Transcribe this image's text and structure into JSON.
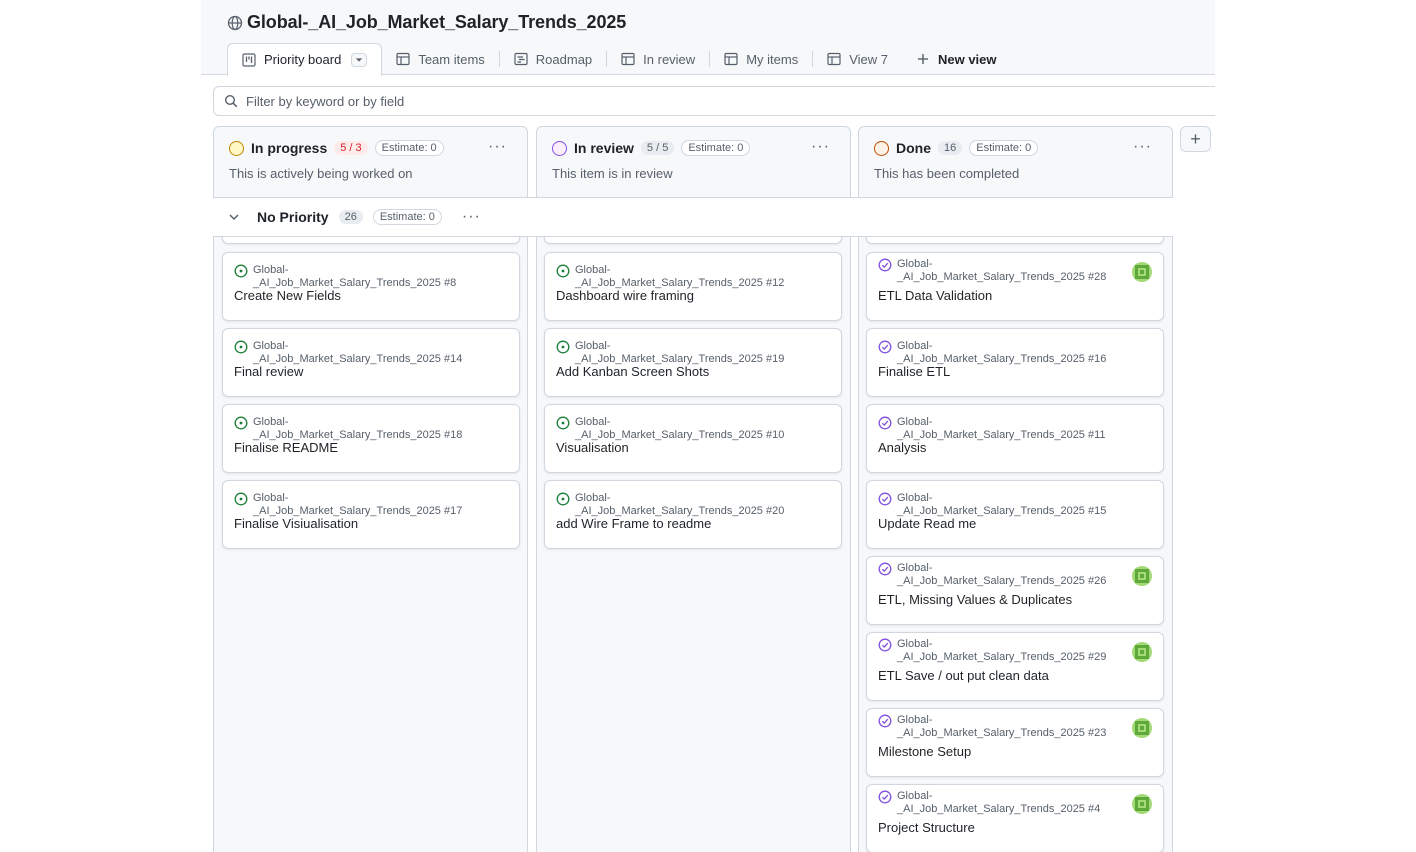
{
  "project": {
    "title": "Global-_AI_Job_Market_Salary_Trends_2025"
  },
  "tabs": [
    {
      "label": "Priority board",
      "icon": "board-icon",
      "active": true
    },
    {
      "label": "Team items",
      "icon": "table-icon"
    },
    {
      "label": "Roadmap",
      "icon": "roadmap-icon"
    },
    {
      "label": "In review",
      "icon": "table-icon"
    },
    {
      "label": "My items",
      "icon": "table-icon"
    },
    {
      "label": "View 7",
      "icon": "table-icon"
    },
    {
      "label": "New view",
      "icon": "plus-icon"
    }
  ],
  "filter": {
    "placeholder": "Filter by keyword or by field"
  },
  "group": {
    "name": "No Priority",
    "count": "26",
    "estimate": "Estimate: 0"
  },
  "columns": [
    {
      "name": "In progress",
      "count": "5 / 3",
      "estimate": "Estimate: 0",
      "description": "This is actively being worked on",
      "color": "#bf8700",
      "cards": [
        {
          "ref": "Global-_AI_Job_Market_Salary_Trends_2025 #8",
          "title": "Create New Fields",
          "state": "open"
        },
        {
          "ref": "Global-_AI_Job_Market_Salary_Trends_2025 #14",
          "title": "Final review",
          "state": "open"
        },
        {
          "ref": "Global-_AI_Job_Market_Salary_Trends_2025 #18",
          "title": "Finalise README",
          "state": "open"
        },
        {
          "ref": "Global-_AI_Job_Market_Salary_Trends_2025 #17",
          "title": "Finalise Visiualisation",
          "state": "open"
        }
      ]
    },
    {
      "name": "In review",
      "count": "5 / 5",
      "estimate": "Estimate: 0",
      "description": "This item is in review",
      "color": "#8250df",
      "cards": [
        {
          "ref": "Global-_AI_Job_Market_Salary_Trends_2025 #12",
          "title": "Dashboard wire framing",
          "state": "open"
        },
        {
          "ref": "Global-_AI_Job_Market_Salary_Trends_2025 #19",
          "title": "Add Kanban Screen Shots",
          "state": "open"
        },
        {
          "ref": "Global-_AI_Job_Market_Salary_Trends_2025 #10",
          "title": "Visualisation",
          "state": "open"
        },
        {
          "ref": "Global-_AI_Job_Market_Salary_Trends_2025 #20",
          "title": "add Wire Frame to readme",
          "state": "open"
        }
      ]
    },
    {
      "name": "Done",
      "count": "16",
      "estimate": "Estimate: 0",
      "description": "This has been completed",
      "color": "#bc4c00",
      "cards": [
        {
          "ref": "Global-_AI_Job_Market_Salary_Trends_2025 #28",
          "title": "ETL Data Validation",
          "state": "closed",
          "avatar": true
        },
        {
          "ref": "Global-_AI_Job_Market_Salary_Trends_2025 #16",
          "title": "Finalise ETL",
          "state": "closed"
        },
        {
          "ref": "Global-_AI_Job_Market_Salary_Trends_2025 #11",
          "title": "Analysis",
          "state": "closed"
        },
        {
          "ref": "Global-_AI_Job_Market_Salary_Trends_2025 #15",
          "title": "Update Read me",
          "state": "closed"
        },
        {
          "ref": "Global-_AI_Job_Market_Salary_Trends_2025 #26",
          "title": "ETL, Missing Values & Duplicates",
          "state": "closed",
          "avatar": true
        },
        {
          "ref": "Global-_AI_Job_Market_Salary_Trends_2025 #29",
          "title": "ETL Save / out put clean data",
          "state": "closed",
          "avatar": true
        },
        {
          "ref": "Global-_AI_Job_Market_Salary_Trends_2025 #23",
          "title": "Milestone Setup",
          "state": "closed",
          "avatar": true
        },
        {
          "ref": "Global-_AI_Job_Market_Salary_Trends_2025 #4",
          "title": "Project Structure",
          "state": "closed",
          "avatar": true
        }
      ]
    }
  ],
  "colors": {
    "open": "#1a7f37",
    "closed": "#8250df",
    "over_limit": "#cf222e"
  }
}
